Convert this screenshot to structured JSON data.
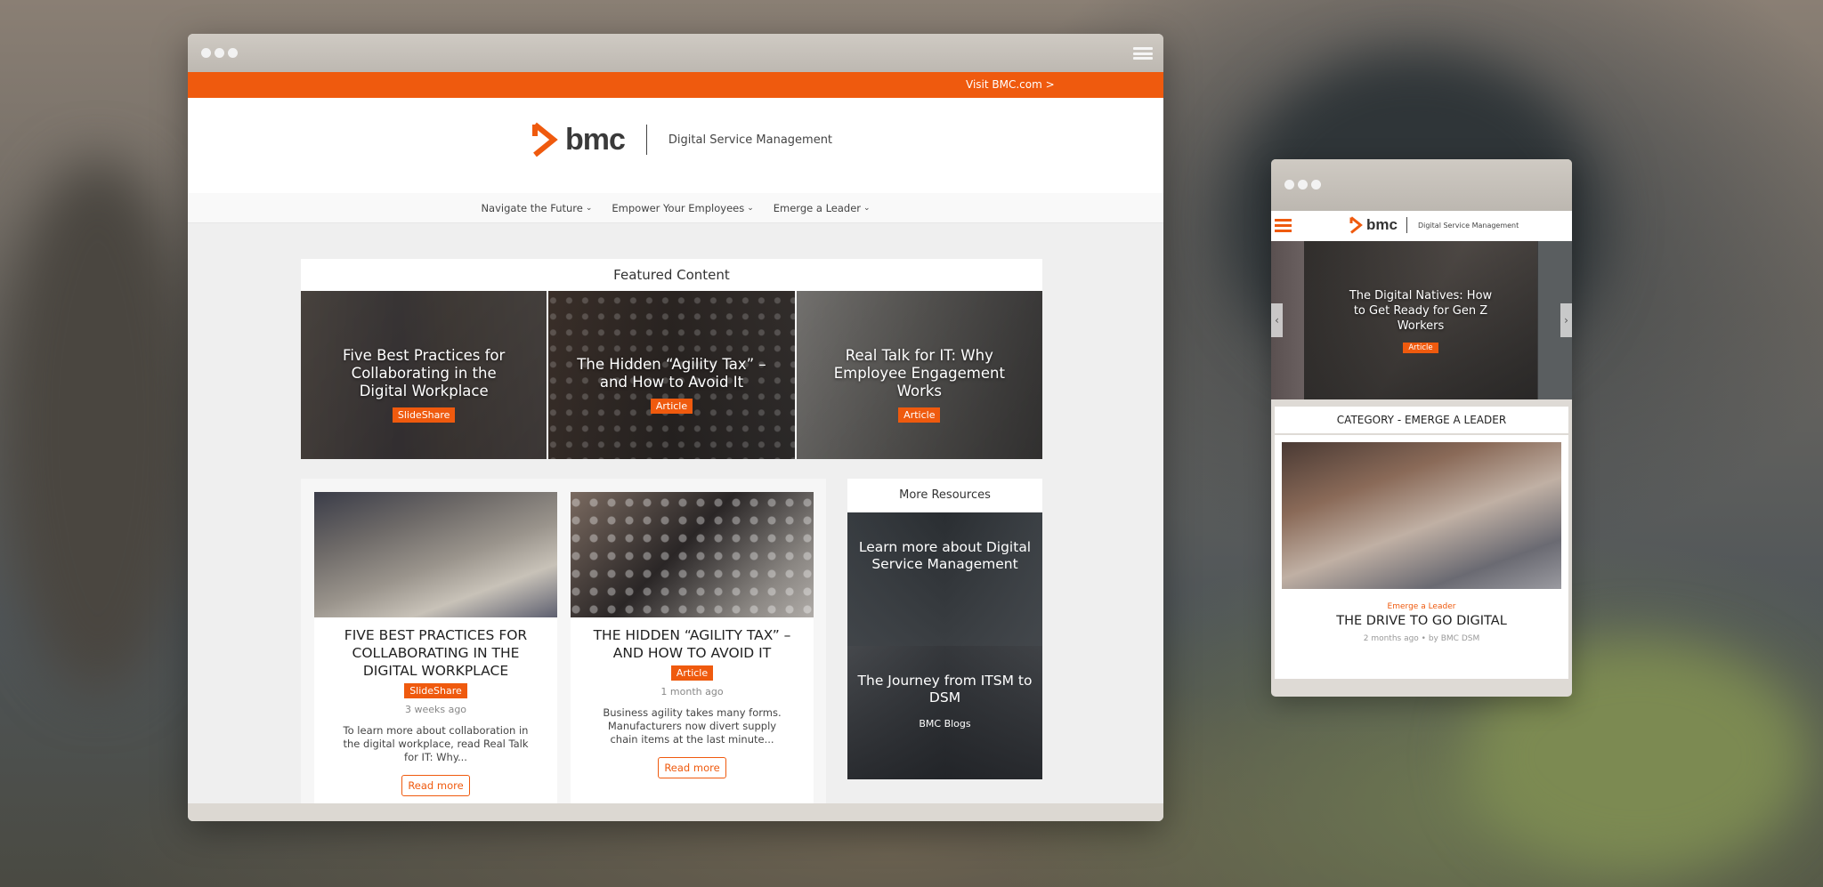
{
  "colors": {
    "accent": "#ef5a0e"
  },
  "topbar": {
    "link": "Visit BMC.com >"
  },
  "brand": {
    "logo": "bmc",
    "subtitle": "Digital Service Management"
  },
  "nav": [
    {
      "label": "Navigate the Future",
      "icon": "chevron-down-icon"
    },
    {
      "label": "Empower Your Employees",
      "icon": "chevron-down-icon"
    },
    {
      "label": "Emerge a Leader",
      "icon": "chevron-down-icon"
    }
  ],
  "featured": {
    "title": "Featured Content",
    "items": [
      {
        "title": "Five Best Practices for Collaborating in the Digital Workplace",
        "badge": "SlideShare"
      },
      {
        "title": "The Hidden “Agility Tax” – and How to Avoid It",
        "badge": "Article"
      },
      {
        "title": "Real Talk for IT: Why Employee Engagement Works",
        "badge": "Article"
      }
    ]
  },
  "cards": [
    {
      "title": "Five Best Practices for Collaborating in the Digital Workplace",
      "badge": "SlideShare",
      "meta": "3 weeks ago",
      "desc": "To learn more about collaboration in the digital workplace, read Real Talk for IT: Why...",
      "button": "Read more"
    },
    {
      "title": "The Hidden “Agility Tax” – and How to Avoid It",
      "badge": "Article",
      "meta": "1 month ago",
      "desc": "Business agility takes many forms. Manufacturers now divert supply chain items at the last minute...",
      "button": "Read more"
    }
  ],
  "more": {
    "title": "More Resources",
    "items": [
      {
        "title": "Learn more about Digital Service Management",
        "sub": ""
      },
      {
        "title": "The Journey from ITSM to DSM",
        "sub": "BMC Blogs"
      }
    ]
  },
  "mobile": {
    "logo": "bmc",
    "subtitle": "Digital Service Management",
    "hero": {
      "title": "The Digital Natives: How to Get Ready for Gen Z Workers",
      "badge": "Article"
    },
    "category": "CATEGORY - EMERGE A LEADER",
    "card": {
      "category": "Emerge a Leader",
      "title": "THE DRIVE TO GO DIGITAL",
      "meta": "2 months ago • by BMC DSM"
    }
  }
}
